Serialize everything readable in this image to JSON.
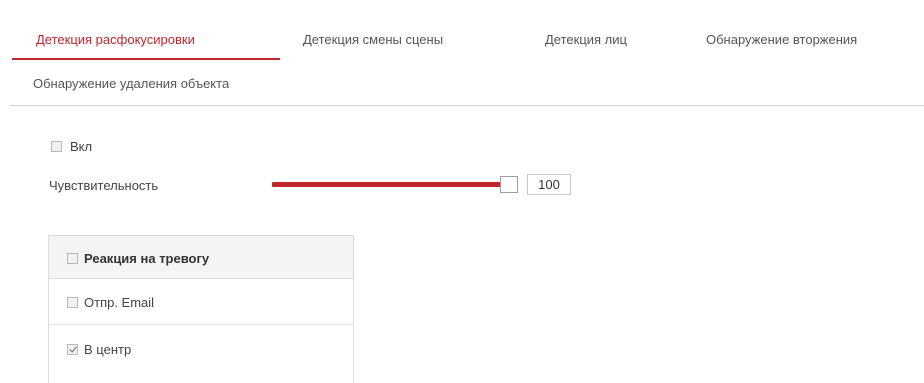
{
  "tabs": [
    {
      "label": "Детекция расфокусировки",
      "active": true
    },
    {
      "label": "Детекция смены сцены",
      "active": false
    },
    {
      "label": "Детекция лиц",
      "active": false
    },
    {
      "label": "Обнаружение вторжения",
      "active": false
    },
    {
      "label": "Обнаружение удаления объекта",
      "active": false
    }
  ],
  "enable": {
    "label": "Вкл",
    "checked": false
  },
  "sensitivity": {
    "label": "Чувствительность",
    "value": "100",
    "level_fraction": 1.0
  },
  "alarm_panel": {
    "header": {
      "label": "Реакция на тревогу",
      "checked": false
    },
    "items": [
      {
        "label": "Отпр. Email",
        "checked": false
      },
      {
        "label": "В центр",
        "checked": true
      }
    ]
  },
  "colors": {
    "accent": "#c0272d",
    "border": "#dcdcdc",
    "text": "#444444"
  }
}
